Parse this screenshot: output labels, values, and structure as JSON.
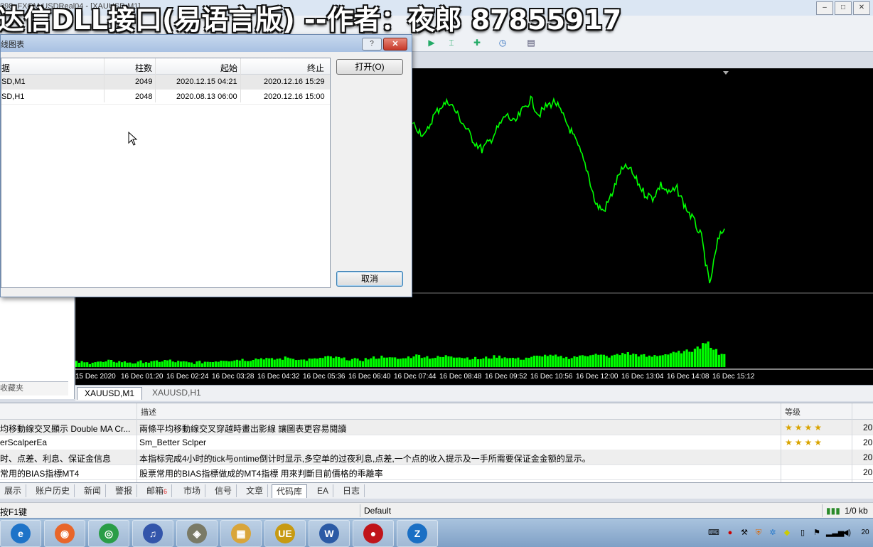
{
  "window": {
    "title": "298: FXCM-USDReal04 - [XAUUSD,M1]"
  },
  "overlay": {
    "title": "达信DLL接口(易语言版) --作者：夜郎 87855917"
  },
  "dialog": {
    "title": "线图表",
    "help_label": "?",
    "close_label": "✕",
    "columns": [
      "据",
      "柱数",
      "起始",
      "终止"
    ],
    "rows": [
      {
        "symbol": "SD,M1",
        "bars": "2049",
        "start": "2020.12.15 04:21",
        "end": "2020.12.16 15:29"
      },
      {
        "symbol": "SD,H1",
        "bars": "2048",
        "start": "2020.08.13 06:00",
        "end": "2020.12.16 15:00"
      }
    ],
    "open_button": "打开(O)",
    "cancel_button": "取消"
  },
  "navigator": {
    "tab_label": "收藏夹"
  },
  "chart": {
    "x_labels": [
      "15 Dec 2020",
      "16 Dec 01:20",
      "16 Dec 02:24",
      "16 Dec 03:28",
      "16 Dec 04:32",
      "16 Dec 05:36",
      "16 Dec 06:40",
      "16 Dec 07:44",
      "16 Dec 08:48",
      "16 Dec 09:52",
      "16 Dec 10:56",
      "16 Dec 12:00",
      "16 Dec 13:04",
      "16 Dec 14:08",
      "16 Dec 15:12"
    ],
    "tabs": [
      "XAUUSD,M1",
      "XAUUSD,H1"
    ],
    "active_tab": 0,
    "line_color": "#00ff00",
    "background": "#000000",
    "price_path": [
      0.8,
      0.78,
      0.82,
      0.84,
      0.86,
      0.83,
      0.8,
      0.82,
      0.79,
      0.78,
      0.8,
      0.77,
      0.74,
      0.72,
      0.7,
      0.66,
      0.58,
      0.52,
      0.5,
      0.48,
      0.5,
      0.53,
      0.52,
      0.55,
      0.5,
      0.46,
      0.48,
      0.52,
      0.54,
      0.58,
      0.62,
      0.66,
      0.7,
      0.72,
      0.68,
      0.65,
      0.62,
      0.6,
      0.62,
      0.38,
      0.22,
      0.16,
      0.2,
      0.24,
      0.15,
      0.1,
      0.08,
      0.14,
      0.2,
      0.26,
      0.3,
      0.26,
      0.2,
      0.14,
      0.18,
      0.12,
      0.07,
      0.14,
      0.1,
      0.08,
      0.15,
      0.22,
      0.3,
      0.4,
      0.55,
      0.58,
      0.5,
      0.4,
      0.38,
      0.44,
      0.5,
      0.52,
      0.46,
      0.5,
      0.48,
      0.56,
      0.62,
      0.7,
      0.92,
      0.72,
      0.64
    ],
    "volume_level": [
      0.06,
      0.05,
      0.07,
      0.06,
      0.08,
      0.07,
      0.06,
      0.05,
      0.07,
      0.06,
      0.08,
      0.09,
      0.07,
      0.06,
      0.05,
      0.06,
      0.07,
      0.08,
      0.1,
      0.09,
      0.11,
      0.1,
      0.12,
      0.13,
      0.11,
      0.12,
      0.14,
      0.12,
      0.1,
      0.11,
      0.13,
      0.15,
      0.14,
      0.12,
      0.11,
      0.1,
      0.12,
      0.14,
      0.16,
      0.13,
      0.12,
      0.15,
      0.18,
      0.16,
      0.14,
      0.15,
      0.17,
      0.16,
      0.14,
      0.13,
      0.12,
      0.14,
      0.16,
      0.15,
      0.13,
      0.12,
      0.14,
      0.16,
      0.18,
      0.17,
      0.15,
      0.14,
      0.16,
      0.18,
      0.2,
      0.18,
      0.16,
      0.19,
      0.22,
      0.2,
      0.18,
      0.16,
      0.18,
      0.2,
      0.22,
      0.24,
      0.26,
      0.32,
      0.4,
      0.3,
      0.2
    ]
  },
  "terminal": {
    "columns": [
      "",
      "描述",
      "等级"
    ],
    "rows": [
      {
        "name": "均移動線交叉顯示 Double MA Cr...",
        "desc": "兩條平均移動線交叉穿越時畫出影線 讓圖表更容易閱讀",
        "rating": 5,
        "extra": "20"
      },
      {
        "name": "erScalperEa",
        "desc": "Sm_Better  Sclper",
        "rating": 5,
        "extra": "20"
      },
      {
        "name": "时、点差、利息、保证金信息",
        "desc": "本指标完成4小时的tick与ontime倒计时显示,多空单的过夜利息,点差,一个点的收入提示及一手所需要保证金金额的显示。",
        "rating": 0,
        "extra": "20"
      },
      {
        "name": "常用的BIAS指標MT4",
        "desc": "股票常用的BIAS指標做成的MT4指標 用來判斷目前價格的乖離率",
        "rating": 0,
        "extra": "20"
      }
    ],
    "tabs": [
      {
        "label": "展示"
      },
      {
        "label": "账户历史"
      },
      {
        "label": "新闻"
      },
      {
        "label": "警报"
      },
      {
        "label": "邮箱",
        "badge": "6"
      },
      {
        "label": "市场"
      },
      {
        "label": "信号"
      },
      {
        "label": "文章"
      },
      {
        "label": "代码库"
      },
      {
        "label": "EA"
      },
      {
        "label": "日志"
      }
    ],
    "active_tab": 8
  },
  "status": {
    "help": "按F1键",
    "profile": "Default",
    "traffic": "1/0 kb"
  },
  "taskbar": {
    "apps": [
      {
        "name": "ie-icon",
        "glyph": "e",
        "color": "#1e73c8"
      },
      {
        "name": "firefox-icon",
        "glyph": "◉",
        "color": "#e8662a"
      },
      {
        "name": "chrome-icon",
        "glyph": "◎",
        "color": "#2a9d47"
      },
      {
        "name": "guitar-icon",
        "glyph": "♫",
        "color": "#3355aa"
      },
      {
        "name": "seal-icon",
        "glyph": "◈",
        "color": "#7a7a66"
      },
      {
        "name": "folder-icon",
        "glyph": "▦",
        "color": "#d9a53a"
      },
      {
        "name": "ultraedit-icon",
        "glyph": "UE",
        "color": "#c79a12"
      },
      {
        "name": "word-icon",
        "glyph": "W",
        "color": "#2b5aa5"
      },
      {
        "name": "record-icon",
        "glyph": "●",
        "color": "#c0141a"
      },
      {
        "name": "zapp-icon",
        "glyph": "Z",
        "color": "#1a6fc4"
      }
    ],
    "clock": "20"
  }
}
